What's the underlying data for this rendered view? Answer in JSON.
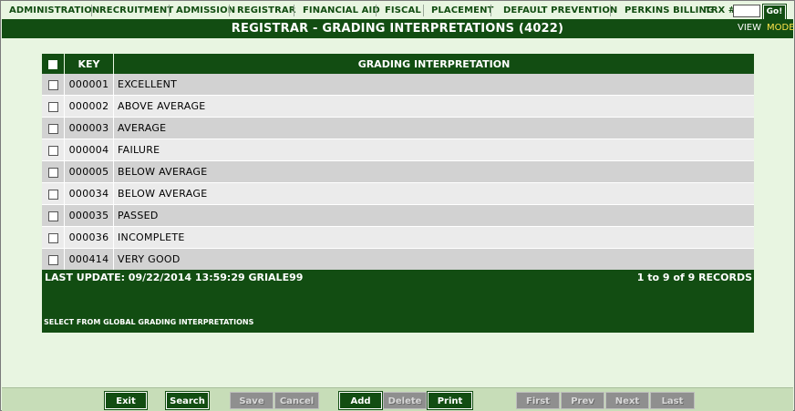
{
  "menu": {
    "items": [
      "ADMINISTRATION",
      "RECRUITMENT",
      "ADMISSION",
      "REGISTRAR",
      "FINANCIAL AID",
      "FISCAL",
      "PLACEMENT",
      "DEFAULT PREVENTION",
      "PERKINS BILLING"
    ],
    "trx_label": "TRX #:",
    "trx_value": "",
    "go_label": "Go!"
  },
  "header": {
    "title": "REGISTRAR - GRADING INTERPRETATIONS (4022)",
    "view_label": "VIEW",
    "mode_label": "MODE"
  },
  "table": {
    "columns": [
      "KEY",
      "GRADING INTERPRETATION"
    ],
    "rows": [
      {
        "key": "000001",
        "desc": "EXCELLENT"
      },
      {
        "key": "000002",
        "desc": "ABOVE AVERAGE"
      },
      {
        "key": "000003",
        "desc": "AVERAGE"
      },
      {
        "key": "000004",
        "desc": "FAILURE"
      },
      {
        "key": "000005",
        "desc": "BELOW AVERAGE"
      },
      {
        "key": "000034",
        "desc": "BELOW AVERAGE"
      },
      {
        "key": "000035",
        "desc": "PASSED"
      },
      {
        "key": "000036",
        "desc": "INCOMPLETE"
      },
      {
        "key": "000414",
        "desc": "VERY GOOD"
      }
    ]
  },
  "footer": {
    "last_update": "LAST UPDATE: 09/22/2014 13:59:29 GRIALE99",
    "records": "1 to 9 of 9 RECORDS",
    "global_note": "SELECT FROM GLOBAL GRADING INTERPRETATIONS"
  },
  "buttons": {
    "exit": "Exit",
    "search": "Search",
    "save": "Save",
    "cancel": "Cancel",
    "add": "Add",
    "delete": "Delete",
    "print": "Print",
    "first": "First",
    "prev": "Prev",
    "next": "Next",
    "last": "Last"
  },
  "colors": {
    "brand_green": "#124d12",
    "background": "#e8f5e1",
    "mode_yellow": "#ffe44a",
    "disabled_gray": "#8f8f8f"
  }
}
